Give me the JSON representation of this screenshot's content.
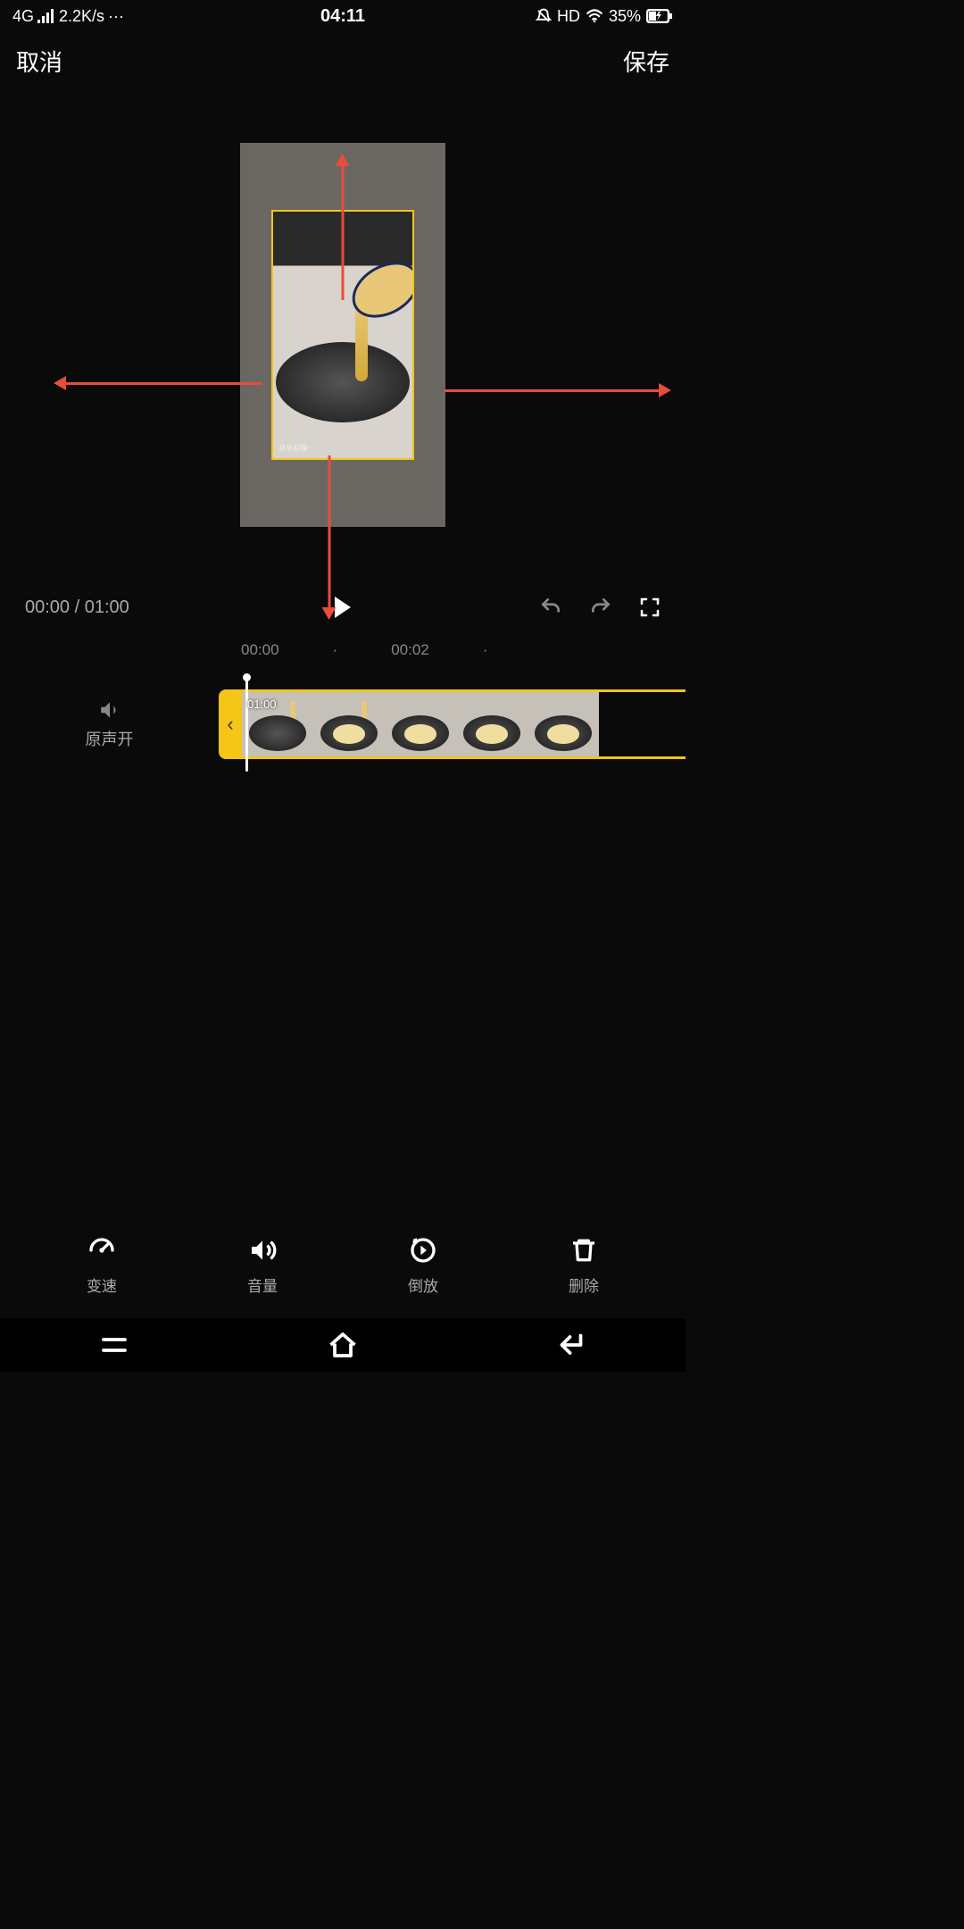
{
  "status": {
    "network": "4G",
    "speed": "2.2K/s",
    "time": "04:11",
    "hd": "HD",
    "battery": "35%"
  },
  "header": {
    "cancel": "取消",
    "save": "保存"
  },
  "preview": {
    "watermark": "@从前慢~"
  },
  "playback": {
    "current": "00:00",
    "separator": "/",
    "total": "01:00"
  },
  "timeline": {
    "tick1": "00:00",
    "dot1": "·",
    "tick2": "00:02",
    "dot2": "·",
    "clip_duration": "01:00",
    "sound_label": "原声开"
  },
  "tools": {
    "speed": "变速",
    "volume": "音量",
    "reverse": "倒放",
    "delete": "删除"
  }
}
